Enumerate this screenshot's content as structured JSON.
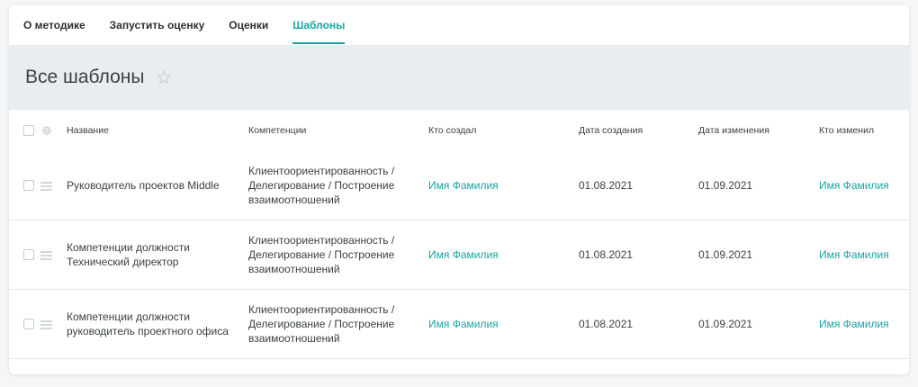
{
  "tabs": [
    {
      "label": "О методике"
    },
    {
      "label": "Запустить оценку"
    },
    {
      "label": "Оценки"
    },
    {
      "label": "Шаблоны"
    }
  ],
  "active_tab": "Шаблоны",
  "page": {
    "title": "Все шаблоны",
    "favorite_icon": "star-outline-icon"
  },
  "table": {
    "headers": {
      "name": "Название",
      "competencies": "Компетенции",
      "author": "Кто создал",
      "created": "Дата создания",
      "changed": "Дата изменения",
      "editor": "Кто изменил"
    },
    "rows": [
      {
        "name": "Руководитель проектов Middle",
        "competencies": [
          "Клиентоориентированность /",
          "Делегирование / Построение",
          "взаимоотношений"
        ],
        "author": "Имя Фамилия",
        "created": "01.08.2021",
        "changed": "01.09.2021",
        "editor": "Имя Фамилия"
      },
      {
        "name": "Компетенции должности Технический директор",
        "competencies": [
          "Клиентоориентированность /",
          "Делегирование / Построение",
          "взаимоотношений"
        ],
        "author": "Имя Фамилия",
        "created": "01.08.2021",
        "changed": "01.09.2021",
        "editor": "Имя Фамилия"
      },
      {
        "name": "Компетенции должности руководитель проектного офиса",
        "competencies": [
          "Клиентоориентированность /",
          "Делегирование / Построение",
          "взаимоотношений"
        ],
        "author": "Имя Фамилия",
        "created": "01.08.2021",
        "changed": "01.09.2021",
        "editor": "Имя Фамилия"
      }
    ]
  },
  "colors": {
    "accent": "#1aa3a3",
    "header_band": "#e8edf0",
    "text": "#3a4045"
  }
}
